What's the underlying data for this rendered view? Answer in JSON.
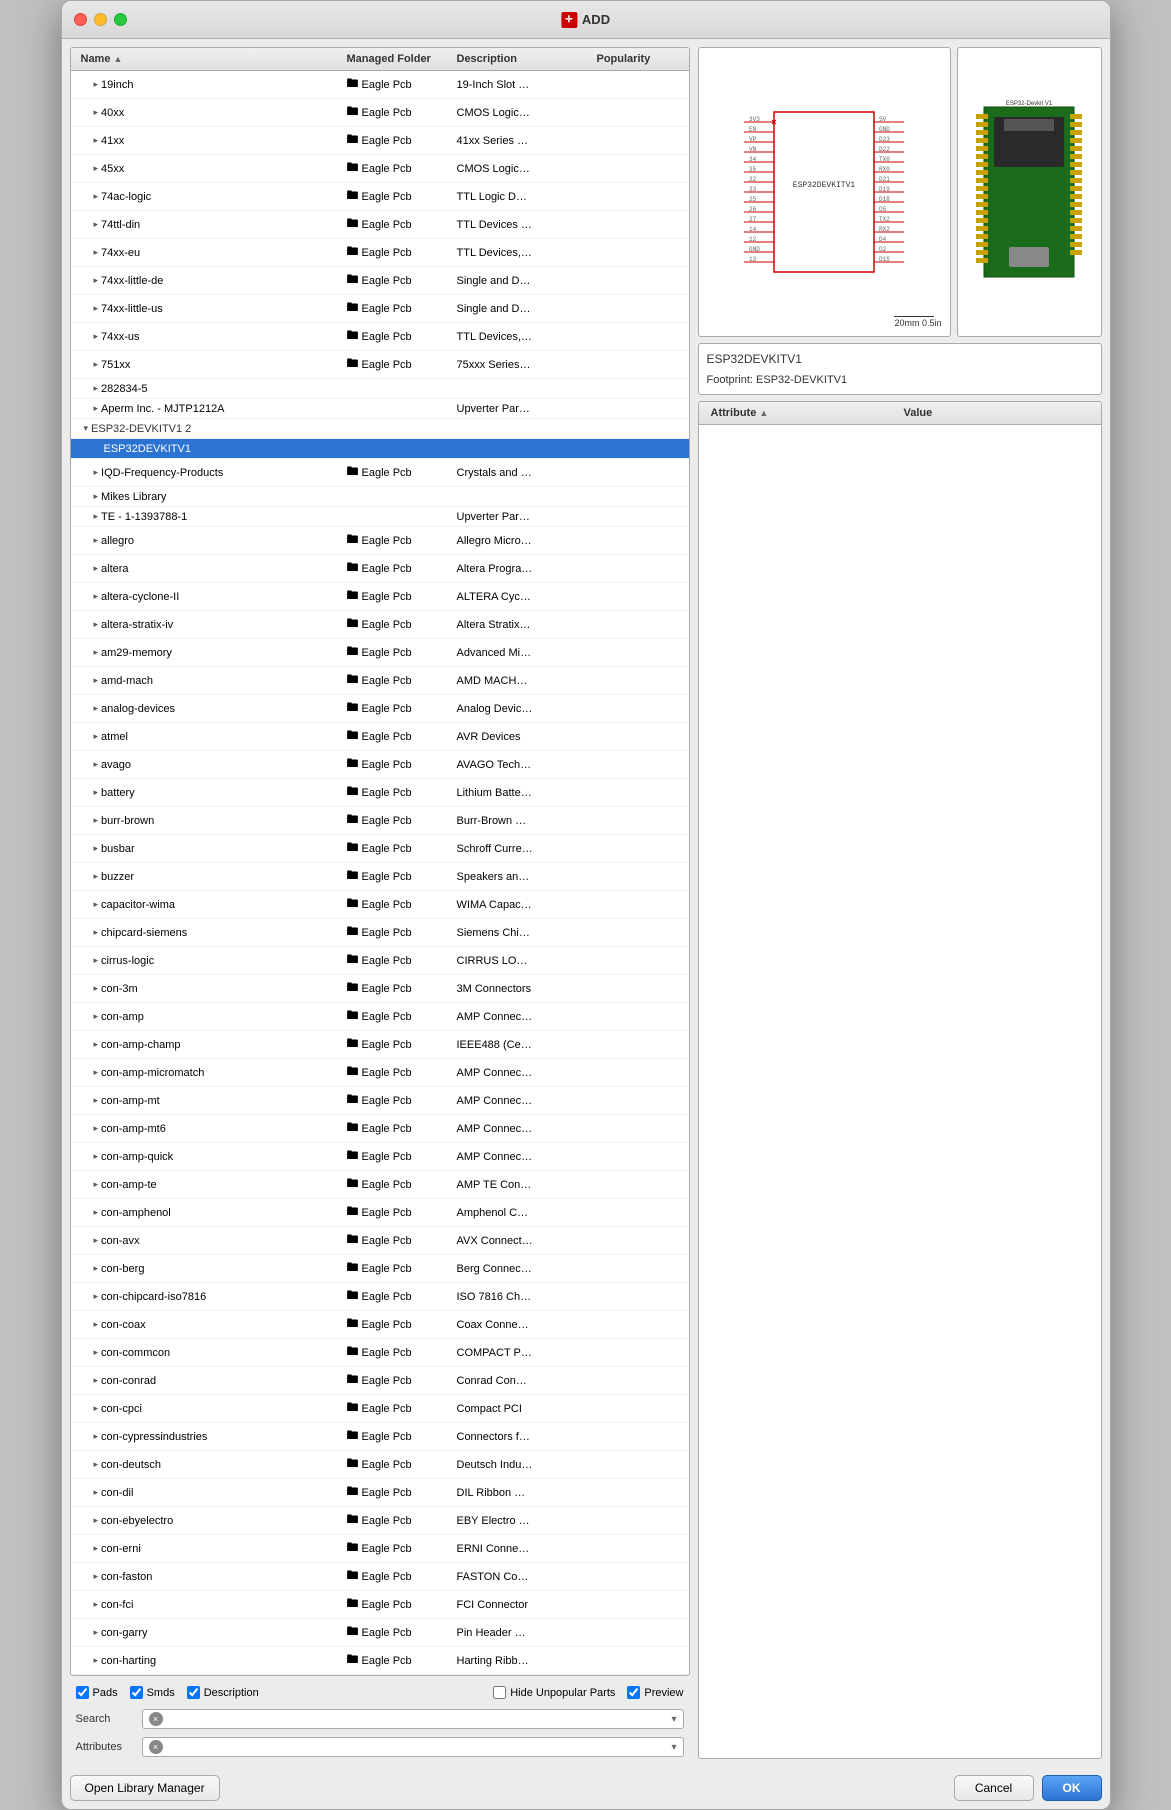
{
  "window": {
    "title": "ADD",
    "title_icon": "✛"
  },
  "table": {
    "columns": [
      "Name",
      "Managed Folder",
      "Description",
      "Popularity"
    ],
    "sort_column": "Name",
    "rows": [
      {
        "indent": 1,
        "name": "19inch",
        "folder": "Eagle Pcb",
        "description": "19-Inch Slot …",
        "has_folder": true,
        "group": false,
        "selected": false
      },
      {
        "indent": 1,
        "name": "40xx",
        "folder": "Eagle Pcb",
        "description": "CMOS Logic…",
        "has_folder": true,
        "group": false,
        "selected": false
      },
      {
        "indent": 1,
        "name": "41xx",
        "folder": "Eagle Pcb",
        "description": "41xx Series …",
        "has_folder": true,
        "group": false,
        "selected": false
      },
      {
        "indent": 1,
        "name": "45xx",
        "folder": "Eagle Pcb",
        "description": "CMOS Logic…",
        "has_folder": true,
        "group": false,
        "selected": false
      },
      {
        "indent": 1,
        "name": "74ac-logic",
        "folder": "Eagle Pcb",
        "description": "TTL Logic D…",
        "has_folder": true,
        "group": false,
        "selected": false
      },
      {
        "indent": 1,
        "name": "74ttl-din",
        "folder": "Eagle Pcb",
        "description": "TTL Devices …",
        "has_folder": true,
        "group": false,
        "selected": false
      },
      {
        "indent": 1,
        "name": "74xx-eu",
        "folder": "Eagle Pcb",
        "description": "TTL Devices,…",
        "has_folder": true,
        "group": false,
        "selected": false
      },
      {
        "indent": 1,
        "name": "74xx-little-de",
        "folder": "Eagle Pcb",
        "description": "Single and D…",
        "has_folder": true,
        "group": false,
        "selected": false
      },
      {
        "indent": 1,
        "name": "74xx-little-us",
        "folder": "Eagle Pcb",
        "description": "Single and D…",
        "has_folder": true,
        "group": false,
        "selected": false
      },
      {
        "indent": 1,
        "name": "74xx-us",
        "folder": "Eagle Pcb",
        "description": "TTL Devices,…",
        "has_folder": true,
        "group": false,
        "selected": false
      },
      {
        "indent": 1,
        "name": "751xx",
        "folder": "Eagle Pcb",
        "description": "75xxx Series…",
        "has_folder": true,
        "group": false,
        "selected": false
      },
      {
        "indent": 1,
        "name": "282834-5",
        "folder": "",
        "description": "",
        "has_folder": false,
        "group": false,
        "selected": false
      },
      {
        "indent": 1,
        "name": "Aperm Inc. - MJTP1212A",
        "folder": "",
        "description": "Upverter Par…",
        "has_folder": false,
        "group": false,
        "selected": false
      },
      {
        "indent": 0,
        "name": "ESP32-DEVKITV1 2",
        "folder": "",
        "description": "",
        "has_folder": false,
        "group": true,
        "expanded": true,
        "selected": false
      },
      {
        "indent": 2,
        "name": "ESP32DEVKITV1",
        "folder": "",
        "description": "",
        "has_folder": false,
        "group": false,
        "selected": true
      },
      {
        "indent": 1,
        "name": "IQD-Frequency-Products",
        "folder": "Eagle Pcb",
        "description": "Crystals and …",
        "has_folder": true,
        "group": false,
        "selected": false
      },
      {
        "indent": 1,
        "name": "Mikes Library",
        "folder": "",
        "description": "",
        "has_folder": false,
        "group": false,
        "selected": false
      },
      {
        "indent": 1,
        "name": "TE - 1-1393788-1",
        "folder": "",
        "description": "Upverter Par…",
        "has_folder": false,
        "group": false,
        "selected": false
      },
      {
        "indent": 1,
        "name": "allegro",
        "folder": "Eagle Pcb",
        "description": "Allegro Micro…",
        "has_folder": true,
        "group": false,
        "selected": false
      },
      {
        "indent": 1,
        "name": "altera",
        "folder": "Eagle Pcb",
        "description": "Altera Progra…",
        "has_folder": true,
        "group": false,
        "selected": false
      },
      {
        "indent": 1,
        "name": "altera-cyclone-II",
        "folder": "Eagle Pcb",
        "description": "ALTERA Cyc…",
        "has_folder": true,
        "group": false,
        "selected": false
      },
      {
        "indent": 1,
        "name": "altera-stratix-iv",
        "folder": "Eagle Pcb",
        "description": "Altera Stratix…",
        "has_folder": true,
        "group": false,
        "selected": false
      },
      {
        "indent": 1,
        "name": "am29-memory",
        "folder": "Eagle Pcb",
        "description": "Advanced Mi…",
        "has_folder": true,
        "group": false,
        "selected": false
      },
      {
        "indent": 1,
        "name": "amd-mach",
        "folder": "Eagle Pcb",
        "description": "AMD MACH…",
        "has_folder": true,
        "group": false,
        "selected": false
      },
      {
        "indent": 1,
        "name": "analog-devices",
        "folder": "Eagle Pcb",
        "description": "Analog Devic…",
        "has_folder": true,
        "group": false,
        "selected": false
      },
      {
        "indent": 1,
        "name": "atmel",
        "folder": "Eagle Pcb",
        "description": "AVR Devices",
        "has_folder": true,
        "group": false,
        "selected": false
      },
      {
        "indent": 1,
        "name": "avago",
        "folder": "Eagle Pcb",
        "description": "AVAGO Tech…",
        "has_folder": true,
        "group": false,
        "selected": false
      },
      {
        "indent": 1,
        "name": "battery",
        "folder": "Eagle Pcb",
        "description": "Lithium Batte…",
        "has_folder": true,
        "group": false,
        "selected": false
      },
      {
        "indent": 1,
        "name": "burr-brown",
        "folder": "Eagle Pcb",
        "description": "Burr-Brown …",
        "has_folder": true,
        "group": false,
        "selected": false
      },
      {
        "indent": 1,
        "name": "busbar",
        "folder": "Eagle Pcb",
        "description": "Schroff Curre…",
        "has_folder": true,
        "group": false,
        "selected": false
      },
      {
        "indent": 1,
        "name": "buzzer",
        "folder": "Eagle Pcb",
        "description": "Speakers an…",
        "has_folder": true,
        "group": false,
        "selected": false
      },
      {
        "indent": 1,
        "name": "capacitor-wima",
        "folder": "Eagle Pcb",
        "description": "WIMA Capac…",
        "has_folder": true,
        "group": false,
        "selected": false
      },
      {
        "indent": 1,
        "name": "chipcard-siemens",
        "folder": "Eagle Pcb",
        "description": "Siemens Chi…",
        "has_folder": true,
        "group": false,
        "selected": false
      },
      {
        "indent": 1,
        "name": "cirrus-logic",
        "folder": "Eagle Pcb",
        "description": "CIRRUS LO…",
        "has_folder": true,
        "group": false,
        "selected": false
      },
      {
        "indent": 1,
        "name": "con-3m",
        "folder": "Eagle Pcb",
        "description": "3M Connectors",
        "has_folder": true,
        "group": false,
        "selected": false
      },
      {
        "indent": 1,
        "name": "con-amp",
        "folder": "Eagle Pcb",
        "description": "AMP Connec…",
        "has_folder": true,
        "group": false,
        "selected": false
      },
      {
        "indent": 1,
        "name": "con-amp-champ",
        "folder": "Eagle Pcb",
        "description": "IEEE488 (Ce…",
        "has_folder": true,
        "group": false,
        "selected": false
      },
      {
        "indent": 1,
        "name": "con-amp-micromatch",
        "folder": "Eagle Pcb",
        "description": "AMP Connec…",
        "has_folder": true,
        "group": false,
        "selected": false
      },
      {
        "indent": 1,
        "name": "con-amp-mt",
        "folder": "Eagle Pcb",
        "description": "AMP Connec…",
        "has_folder": true,
        "group": false,
        "selected": false
      },
      {
        "indent": 1,
        "name": "con-amp-mt6",
        "folder": "Eagle Pcb",
        "description": "AMP Connec…",
        "has_folder": true,
        "group": false,
        "selected": false
      },
      {
        "indent": 1,
        "name": "con-amp-quick",
        "folder": "Eagle Pcb",
        "description": "AMP Connec…",
        "has_folder": true,
        "group": false,
        "selected": false
      },
      {
        "indent": 1,
        "name": "con-amp-te",
        "folder": "Eagle Pcb",
        "description": "AMP TE Con…",
        "has_folder": true,
        "group": false,
        "selected": false
      },
      {
        "indent": 1,
        "name": "con-amphenol",
        "folder": "Eagle Pcb",
        "description": "Amphenol C…",
        "has_folder": true,
        "group": false,
        "selected": false
      },
      {
        "indent": 1,
        "name": "con-avx",
        "folder": "Eagle Pcb",
        "description": "AVX Connect…",
        "has_folder": true,
        "group": false,
        "selected": false
      },
      {
        "indent": 1,
        "name": "con-berg",
        "folder": "Eagle Pcb",
        "description": "Berg Connec…",
        "has_folder": true,
        "group": false,
        "selected": false
      },
      {
        "indent": 1,
        "name": "con-chipcard-iso7816",
        "folder": "Eagle Pcb",
        "description": "ISO 7816 Ch…",
        "has_folder": true,
        "group": false,
        "selected": false
      },
      {
        "indent": 1,
        "name": "con-coax",
        "folder": "Eagle Pcb",
        "description": "Coax Conne…",
        "has_folder": true,
        "group": false,
        "selected": false
      },
      {
        "indent": 1,
        "name": "con-commcon",
        "folder": "Eagle Pcb",
        "description": "COMPACT P…",
        "has_folder": true,
        "group": false,
        "selected": false
      },
      {
        "indent": 1,
        "name": "con-conrad",
        "folder": "Eagle Pcb",
        "description": "Conrad Con…",
        "has_folder": true,
        "group": false,
        "selected": false
      },
      {
        "indent": 1,
        "name": "con-cpci",
        "folder": "Eagle Pcb",
        "description": "Compact PCI",
        "has_folder": true,
        "group": false,
        "selected": false
      },
      {
        "indent": 1,
        "name": "con-cypressindustries",
        "folder": "Eagle Pcb",
        "description": "Connectors f…",
        "has_folder": true,
        "group": false,
        "selected": false
      },
      {
        "indent": 1,
        "name": "con-deutsch",
        "folder": "Eagle Pcb",
        "description": "Deutsch Indu…",
        "has_folder": true,
        "group": false,
        "selected": false
      },
      {
        "indent": 1,
        "name": "con-dil",
        "folder": "Eagle Pcb",
        "description": "DIL Ribbon …",
        "has_folder": true,
        "group": false,
        "selected": false
      },
      {
        "indent": 1,
        "name": "con-ebyelectro",
        "folder": "Eagle Pcb",
        "description": "EBY Electro …",
        "has_folder": true,
        "group": false,
        "selected": false
      },
      {
        "indent": 1,
        "name": "con-erni",
        "folder": "Eagle Pcb",
        "description": "ERNI Conne…",
        "has_folder": true,
        "group": false,
        "selected": false
      },
      {
        "indent": 1,
        "name": "con-faston",
        "folder": "Eagle Pcb",
        "description": "FASTON Co…",
        "has_folder": true,
        "group": false,
        "selected": false
      },
      {
        "indent": 1,
        "name": "con-fci",
        "folder": "Eagle Pcb",
        "description": "FCI Connector",
        "has_folder": true,
        "group": false,
        "selected": false
      },
      {
        "indent": 1,
        "name": "con-garry",
        "folder": "Eagle Pcb",
        "description": "Pin Header …",
        "has_folder": true,
        "group": false,
        "selected": false
      },
      {
        "indent": 1,
        "name": "con-harting",
        "folder": "Eagle Pcb",
        "description": "Harting Ribb…",
        "has_folder": true,
        "group": false,
        "selected": false
      }
    ]
  },
  "checkboxes": {
    "pads": {
      "label": "Pads",
      "checked": true
    },
    "smds": {
      "label": "Smds",
      "checked": true
    },
    "description": {
      "label": "Description",
      "checked": true
    },
    "hide_unpopular": {
      "label": "Hide Unpopular Parts",
      "checked": false
    },
    "preview": {
      "label": "Preview",
      "checked": true
    }
  },
  "search": {
    "label": "Search",
    "placeholder": "",
    "clear_label": "×"
  },
  "attributes": {
    "label": "Attributes",
    "columns": [
      "Attribute",
      "Value"
    ]
  },
  "preview": {
    "component_name": "ESP32DEVKITV1",
    "footprint": "Footprint: ESP32-DEVKITV1",
    "scale_label": "20mm\n0.5in",
    "label_right": "ESP32-Devkit V1"
  },
  "buttons": {
    "open_library_manager": "Open Library Manager",
    "cancel": "Cancel",
    "ok": "OK"
  }
}
